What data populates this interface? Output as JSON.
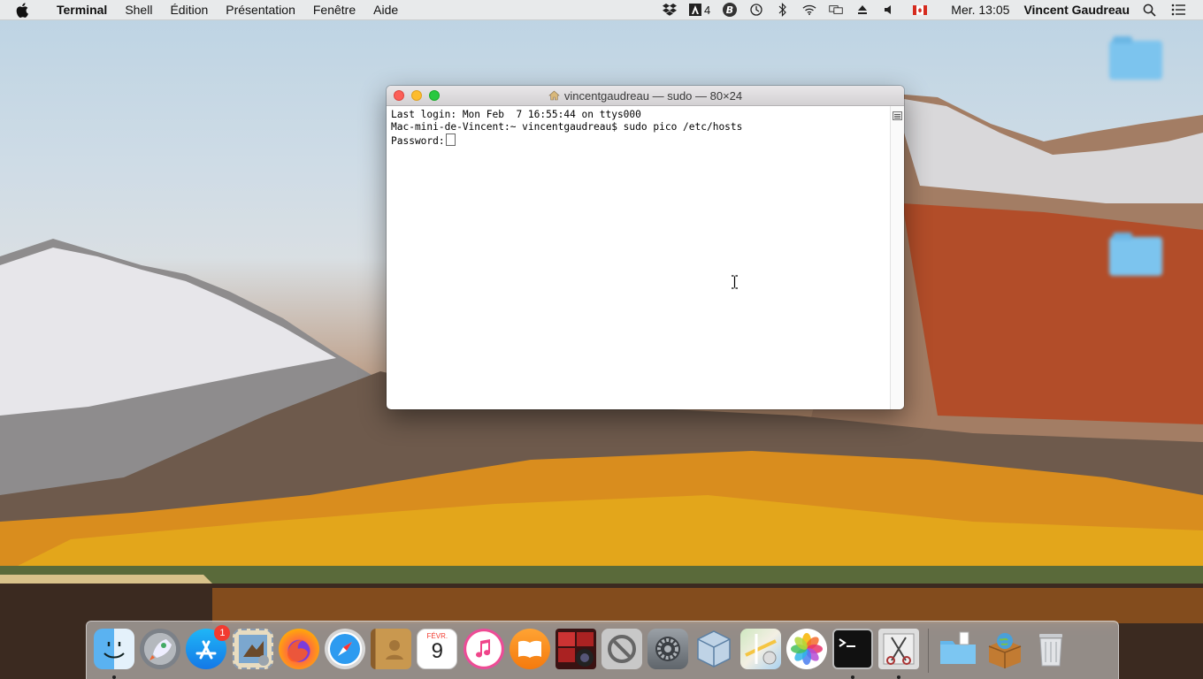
{
  "menubar": {
    "app_name": "Terminal",
    "menus": [
      "Shell",
      "Édition",
      "Présentation",
      "Fenêtre",
      "Aide"
    ],
    "status": {
      "notification_count": "4",
      "clock": "Mer. 13:05",
      "user": "Vincent Gaudreau"
    }
  },
  "terminal": {
    "title": "vincentgaudreau — sudo — 80×24",
    "lines": {
      "login": "Last login: Mon Feb  7 16:55:44 on ttys000",
      "command": "Mac-mini-de-Vincent:~ vincentgaudreau$ sudo pico /etc/hosts",
      "password": "Password:"
    }
  },
  "dock": {
    "app_store_badge": "1",
    "calendar_month": "FÉVR.",
    "calendar_day": "9",
    "apps": [
      "finder",
      "launchpad",
      "app-store",
      "mail",
      "firefox",
      "safari",
      "contacts",
      "calendar",
      "itunes",
      "ibooks",
      "photo-booth",
      "utility",
      "system-preferences",
      "virtualbox",
      "maps",
      "photos",
      "terminal",
      "scissors",
      "downloads-folder",
      "archive-utility",
      "trash"
    ]
  },
  "colors": {
    "close": "#fc5f57",
    "minimize": "#fdbc2e",
    "maximize": "#28c840",
    "badge": "#f23b30"
  }
}
